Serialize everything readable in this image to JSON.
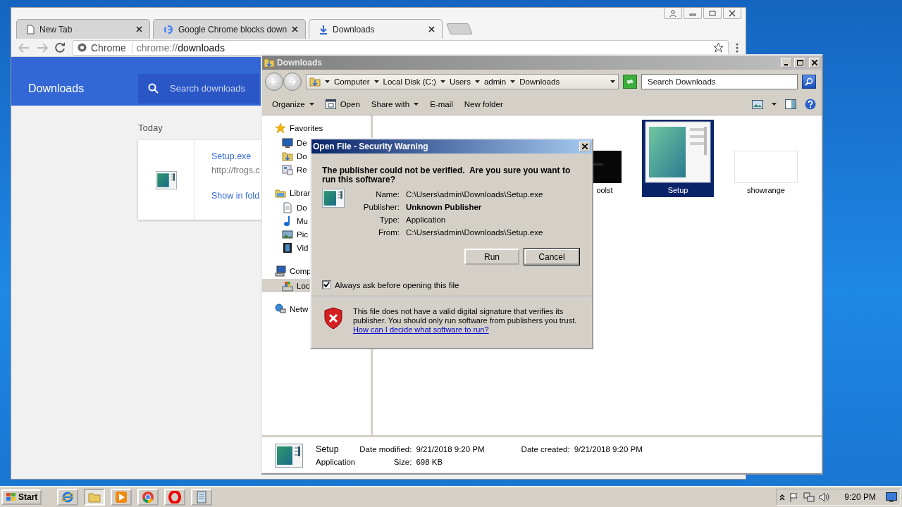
{
  "chrome": {
    "tabs": [
      {
        "title": "New Tab",
        "kind": "page",
        "selected": false
      },
      {
        "title": "Google Chrome blocks down",
        "kind": "google",
        "selected": false
      },
      {
        "title": "Downloads",
        "kind": "download",
        "selected": true
      }
    ],
    "omnibox": {
      "badge": "Chrome",
      "scheme": "chrome://",
      "path": "downloads"
    },
    "page": {
      "title": "Downloads",
      "search_placeholder": "Search downloads",
      "date": "Today",
      "download": {
        "filename": "Setup.exe",
        "url": "http://frogs.c",
        "action": "Show in fold"
      }
    }
  },
  "explorer": {
    "title": "Downloads",
    "breadcrumb": [
      "Computer",
      "Local Disk (C:)",
      "Users",
      "admin",
      "Downloads"
    ],
    "search_placeholder": "Search Downloads",
    "toolbar": [
      {
        "label": "Organize",
        "kind": "menu"
      },
      {
        "label": "Open",
        "kind": "icon"
      },
      {
        "label": "Share with",
        "kind": "menu"
      },
      {
        "label": "E-mail",
        "kind": "plain"
      },
      {
        "label": "New folder",
        "kind": "plain"
      }
    ],
    "nav": [
      {
        "label": "Favorites",
        "kind": "star",
        "selected": false,
        "children": [
          {
            "label": "De",
            "kind": "desktop",
            "selected": false
          },
          {
            "label": "Do",
            "kind": "downloads",
            "selected": false
          },
          {
            "label": "Re",
            "kind": "recent",
            "selected": false
          }
        ]
      },
      {
        "label": "Librar",
        "kind": "library",
        "selected": false,
        "children": [
          {
            "label": "Do",
            "kind": "document",
            "selected": false
          },
          {
            "label": "Mu",
            "kind": "music",
            "selected": false
          },
          {
            "label": "Pic",
            "kind": "picture",
            "selected": false
          },
          {
            "label": "Vid",
            "kind": "video",
            "selected": false
          }
        ]
      },
      {
        "label": "Comp",
        "kind": "computer",
        "selected": false,
        "children": [
          {
            "label": "Loc",
            "kind": "disk",
            "selected": true
          }
        ]
      },
      {
        "label": "Netw",
        "kind": "network",
        "selected": false
      }
    ],
    "files": [
      {
        "name": "oolst",
        "kind": "dark",
        "selected": false
      },
      {
        "name": "Setup",
        "kind": "app",
        "selected": true
      },
      {
        "name": "showrange",
        "kind": "blank",
        "selected": false
      }
    ],
    "details": {
      "name": "Setup",
      "type": "Application",
      "modified_label": "Date modified:",
      "modified": "9/21/2018 9:20 PM",
      "created_label": "Date created:",
      "created": "9/21/2018 9:20 PM",
      "size_label": "Size:",
      "size": "698 KB"
    }
  },
  "dialog": {
    "title": "Open File - Security Warning",
    "question": "The publisher could not be verified.  Are you sure you want to run this software?",
    "fields": [
      {
        "label": "Name:",
        "value": "C:\\Users\\admin\\Downloads\\Setup.exe",
        "emphasis": false
      },
      {
        "label": "Publisher:",
        "value": "Unknown Publisher",
        "emphasis": true
      },
      {
        "label": "Type:",
        "value": "Application",
        "emphasis": false
      },
      {
        "label": "From:",
        "value": "C:\\Users\\admin\\Downloads\\Setup.exe",
        "emphasis": false
      }
    ],
    "buttons": [
      {
        "label": "Run",
        "default": false
      },
      {
        "label": "Cancel",
        "default": true
      }
    ],
    "always_ask": {
      "label": "Always ask before opening this file",
      "checked": true
    },
    "warning": "This file does not have a valid digital signature that verifies its publisher.  You should only run software from publishers you trust.",
    "link": "How can I decide what software to run?"
  },
  "taskbar": {
    "start": "Start",
    "apps": [
      {
        "kind": "ie",
        "active": false
      },
      {
        "kind": "explorer",
        "active": true
      },
      {
        "kind": "media",
        "active": false
      },
      {
        "kind": "chrome",
        "active": false
      },
      {
        "kind": "opera",
        "active": false
      },
      {
        "kind": "notepad",
        "active": false
      }
    ],
    "clock": "9:20 PM"
  }
}
